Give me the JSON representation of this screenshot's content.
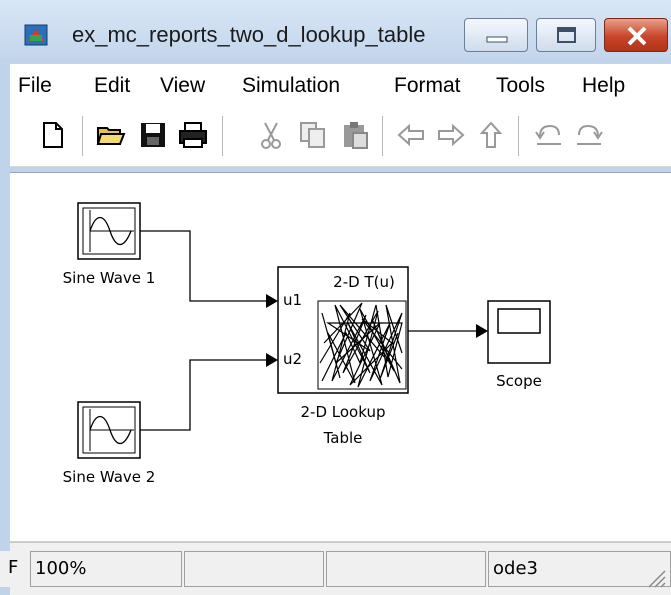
{
  "window": {
    "title": "ex_mc_reports_two_d_lookup_table"
  },
  "menu": [
    "File",
    "Edit",
    "View",
    "Simulation",
    "Format",
    "Tools",
    "Help"
  ],
  "toolbar": {
    "buttons": [
      "new-file",
      "open-folder",
      "save",
      "print",
      "cut",
      "copy",
      "paste",
      "back",
      "forward",
      "up",
      "undo",
      "redo"
    ]
  },
  "diagram": {
    "blocks": {
      "sine1": {
        "label": "Sine Wave 1"
      },
      "sine2": {
        "label": "Sine Wave 2"
      },
      "lookup": {
        "title": "2-D T(u)",
        "port1": "u1",
        "port2": "u2",
        "label_line1": "2-D Lookup",
        "label_line2": "Table"
      },
      "scope": {
        "label": "Scope"
      }
    }
  },
  "status": {
    "left_fragment": "F",
    "zoom": "100%",
    "cell2": "",
    "cell3": "",
    "solver": "ode3"
  },
  "colors": {
    "title_gradient_top": "#d9e7f6",
    "close_button": "#c8452b",
    "canvas": "#ffffff"
  }
}
